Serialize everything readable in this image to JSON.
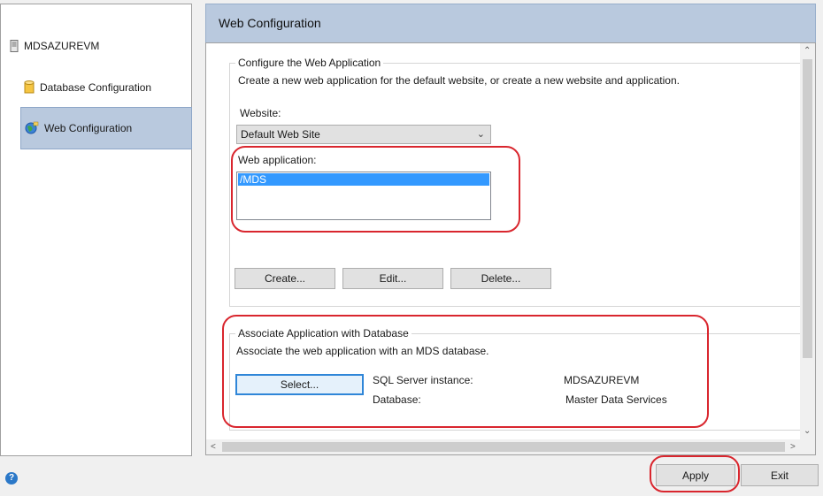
{
  "sidebar": {
    "server": "MDSAZUREVM",
    "items": [
      {
        "label": "Database Configuration"
      },
      {
        "label": "Web Configuration"
      }
    ]
  },
  "header": {
    "title": "Web Configuration"
  },
  "web_app_section": {
    "title": "Configure the Web Application",
    "description": "Create a new web application for the default website, or create a new website and application.",
    "website_label": "Website:",
    "website_value": "Default Web Site",
    "web_application_label": "Web application:",
    "web_applications": [
      "/MDS"
    ],
    "buttons": {
      "create": "Create...",
      "edit": "Edit...",
      "delete": "Delete..."
    }
  },
  "association_section": {
    "title": "Associate Application with Database",
    "description": "Associate the web application with an MDS database.",
    "select_button": "Select...",
    "sql_instance_label": "SQL Server instance:",
    "sql_instance_value": "MDSAZUREVM",
    "database_label": "Database:",
    "database_value": "Master Data Services"
  },
  "footer": {
    "apply": "Apply",
    "exit": "Exit"
  },
  "colors": {
    "highlight": "#b9c9de",
    "annotation": "#d9262e",
    "selection": "#3399ff"
  }
}
